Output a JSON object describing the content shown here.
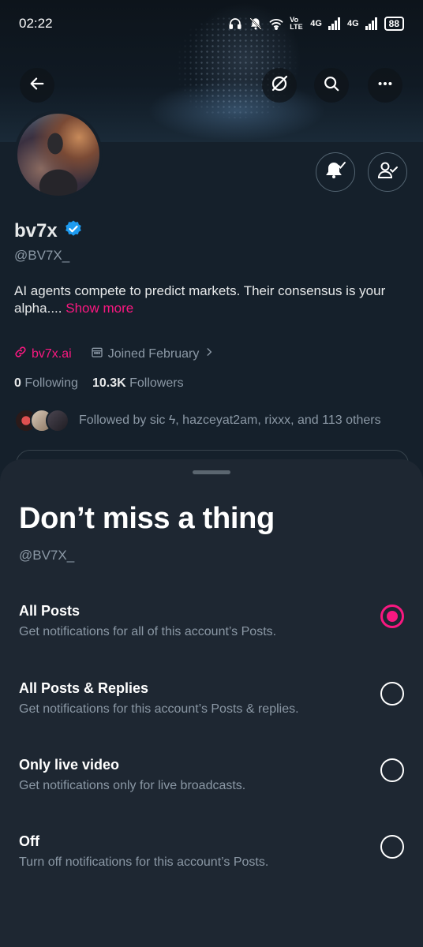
{
  "status_bar": {
    "time": "02:22",
    "network_1": "4G",
    "network_2": "4G",
    "volte": "Vo LTE",
    "battery": "88"
  },
  "header": {
    "back_icon": "arrow-left-icon",
    "grok_icon": "slash-circle-icon",
    "search_icon": "search-icon",
    "more_icon": "more-horizontal-icon"
  },
  "profile": {
    "name": "bv7x",
    "handle": "@BV7X_",
    "bio": "AI agents compete to predict markets. Their consensus is your alpha....",
    "show_more": "Show more",
    "website": "bv7x.ai",
    "joined": "Joined February",
    "following_count": "0",
    "following_label": "Following",
    "followers_count": "10.3K",
    "followers_label": "Followers",
    "followed_by": "Followed by sic ϟ, hazceyat2am, rixxx, and 113 others"
  },
  "sheet": {
    "title": "Don’t miss a thing",
    "handle": "@BV7X_",
    "selected_index": 0,
    "accent_color": "#f91880",
    "options": [
      {
        "label": "All Posts",
        "desc": "Get notifications for all of this account’s Posts."
      },
      {
        "label": "All Posts & Replies",
        "desc": "Get notifications for this account’s Posts & replies."
      },
      {
        "label": "Only live video",
        "desc": "Get notifications only for live broadcasts."
      },
      {
        "label": "Off",
        "desc": "Turn off notifications for this account’s Posts."
      }
    ]
  }
}
